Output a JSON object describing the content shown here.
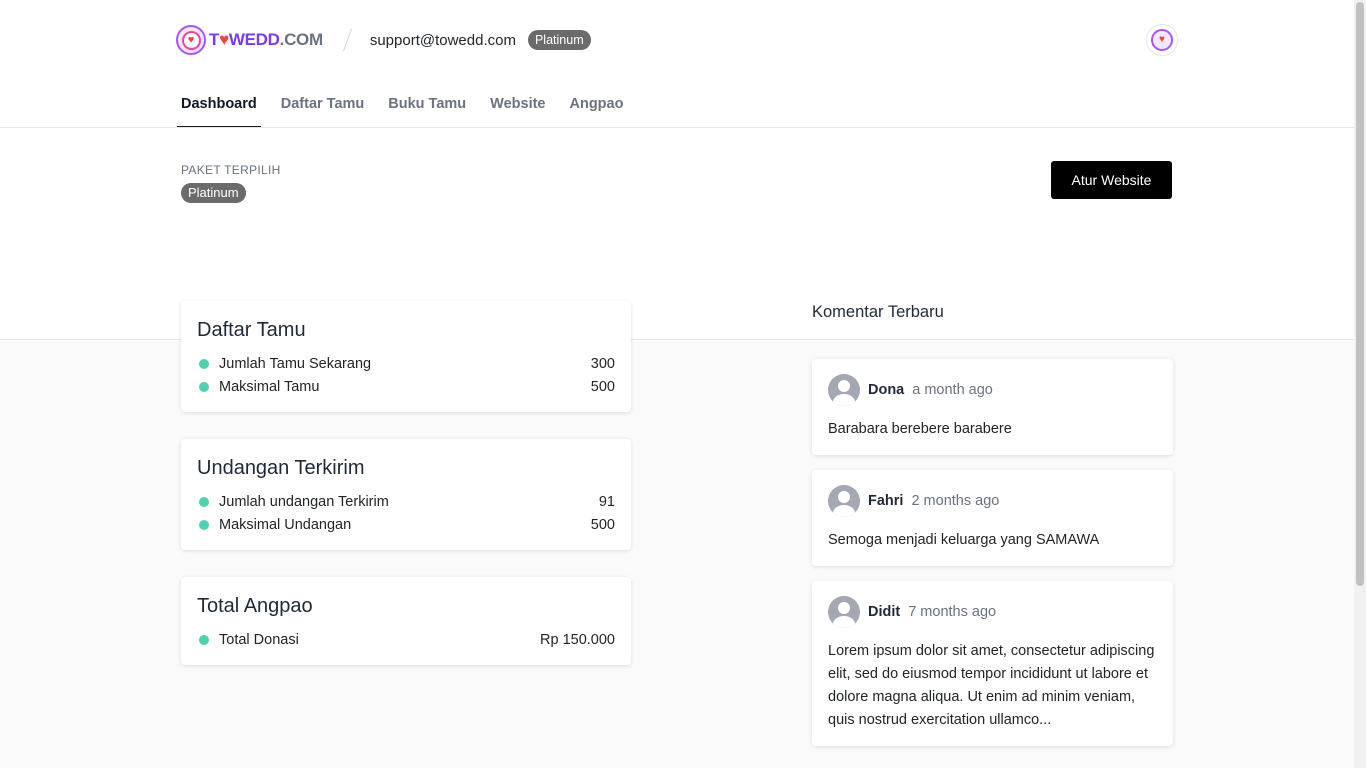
{
  "header": {
    "logo": {
      "t": "T",
      "heart": "♥",
      "rest": "WEDD",
      "dotcom": ".COM"
    },
    "email": "support@towedd.com",
    "plan_badge": "Platinum"
  },
  "tabs": [
    {
      "label": "Dashboard",
      "active": true
    },
    {
      "label": "Daftar Tamu",
      "active": false
    },
    {
      "label": "Buku Tamu",
      "active": false
    },
    {
      "label": "Website",
      "active": false
    },
    {
      "label": "Angpao",
      "active": false
    }
  ],
  "package": {
    "label": "PAKET TERPILIH",
    "value": "Platinum",
    "button": "Atur Website"
  },
  "stats": {
    "guests": {
      "title": "Daftar Tamu",
      "rows": [
        {
          "label": "Jumlah Tamu Sekarang",
          "value": "300"
        },
        {
          "label": "Maksimal Tamu",
          "value": "500"
        }
      ]
    },
    "invitations": {
      "title": "Undangan Terkirim",
      "rows": [
        {
          "label": "Jumlah undangan Terkirim",
          "value": "91"
        },
        {
          "label": "Maksimal Undangan",
          "value": "500"
        }
      ]
    },
    "angpao": {
      "title": "Total Angpao",
      "rows": [
        {
          "label": "Total Donasi",
          "value": "Rp 150.000"
        }
      ]
    }
  },
  "comments": {
    "title": "Komentar Terbaru",
    "items": [
      {
        "name": "Dona",
        "time": "a month ago",
        "text": "Barabara berebere barabere"
      },
      {
        "name": "Fahri",
        "time": "2 months ago",
        "text": "Semoga menjadi keluarga yang SAMAWA"
      },
      {
        "name": "Didit",
        "time": "7 months ago",
        "text": "Lorem ipsum dolor sit amet, consectetur adipiscing elit, sed do eiusmod tempor incididunt ut labore et dolore magna aliqua. Ut enim ad minim veniam, quis nostrud exercitation ullamco..."
      }
    ]
  },
  "colors": {
    "accent": "#000000",
    "dot": "#4fd1b0",
    "logo_purple": "#7c3aed",
    "logo_heart": "#ef4444"
  }
}
